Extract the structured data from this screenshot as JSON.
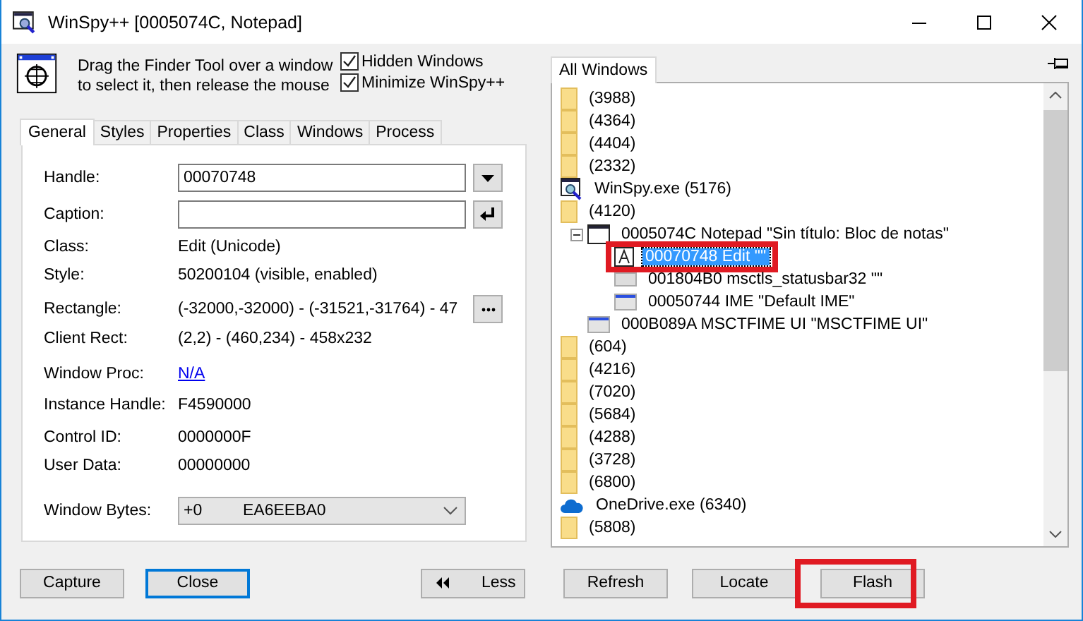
{
  "window": {
    "title": "WinSpy++ [0005074C, Notepad]"
  },
  "finder": {
    "hint": "Drag the Finder Tool over a window to select it, then release the mouse"
  },
  "options": [
    {
      "label": "Hidden Windows",
      "checked": true
    },
    {
      "label": "Minimize WinSpy++",
      "checked": true
    }
  ],
  "tabs": [
    {
      "label": "General",
      "selected": true
    },
    {
      "label": "Styles",
      "selected": false
    },
    {
      "label": "Properties",
      "selected": false
    },
    {
      "label": "Class",
      "selected": false
    },
    {
      "label": "Windows",
      "selected": false
    },
    {
      "label": "Process",
      "selected": false
    }
  ],
  "fields": [
    {
      "kind": "input",
      "label": "Handle:",
      "value": "00070748"
    },
    {
      "kind": "input_enter",
      "label": "Caption:"
    },
    {
      "kind": "text",
      "label": "Class:",
      "value": "Edit  (Unicode)"
    },
    {
      "kind": "text",
      "label": "Style:",
      "value": "50200104  (visible, enabled)"
    },
    {
      "kind": "text_more",
      "label": "Rectangle:",
      "value": "(-32000,-32000) - (-31521,-31764)  -  47"
    },
    {
      "kind": "text",
      "label": "Client Rect:",
      "value": "(2,2) - (460,234)  -  458x232"
    },
    {
      "kind": "link",
      "label": "Window Proc:",
      "value": "N/A"
    },
    {
      "kind": "text",
      "label": "Instance Handle:",
      "value": "F4590000"
    },
    {
      "kind": "text",
      "label": "Control ID:",
      "value": "0000000F"
    },
    {
      "kind": "text",
      "label": "User Data:",
      "value": "00000000"
    },
    {
      "kind": "combo",
      "label": "Window Bytes:",
      "value": "+0",
      "value_2": "EA6EEBA0"
    }
  ],
  "tree": {
    "tab": "All Windows",
    "nodes": [
      {
        "kind": "folder",
        "label": "(3988)",
        "selected": false,
        "highlighted": false
      },
      {
        "kind": "folder",
        "label": "(4364)",
        "selected": false,
        "highlighted": false
      },
      {
        "kind": "folder",
        "label": "(4404)",
        "selected": false,
        "highlighted": false
      },
      {
        "kind": "folder",
        "label": "(2332)",
        "selected": false,
        "highlighted": false
      },
      {
        "kind": "app",
        "label": "WinSpy.exe  (5176)",
        "selected": false,
        "highlighted": false
      },
      {
        "kind": "folder",
        "label": "(4120)",
        "selected": false,
        "highlighted": false,
        "children": [
          {
            "kind": "window",
            "label": "0005074C  Notepad  \"Sin título: Bloc de notas\"",
            "selected": false,
            "highlighted": false,
            "expanded": true,
            "children": [
              {
                "kind": "edit",
                "label": "00070748  Edit  \"\"",
                "selected": true,
                "highlighted": true
              },
              {
                "kind": "statusbar",
                "label": "001804B0  msctls_statusbar32  \"\"",
                "selected": false,
                "highlighted": false
              },
              {
                "kind": "ime",
                "label": "00050744  IME  \"Default IME\"",
                "selected": false,
                "highlighted": false
              }
            ]
          },
          {
            "kind": "ime",
            "label": "000B089A  MSCTFIME UI  \"MSCTFIME UI\"",
            "selected": false,
            "highlighted": false
          }
        ]
      },
      {
        "kind": "folder",
        "label": "(604)",
        "selected": false,
        "highlighted": false
      },
      {
        "kind": "folder",
        "label": "(4216)",
        "selected": false,
        "highlighted": false
      },
      {
        "kind": "folder",
        "label": "(7020)",
        "selected": false,
        "highlighted": false
      },
      {
        "kind": "folder",
        "label": "(5684)",
        "selected": false,
        "highlighted": false
      },
      {
        "kind": "folder",
        "label": "(4288)",
        "selected": false,
        "highlighted": false
      },
      {
        "kind": "folder",
        "label": "(3728)",
        "selected": false,
        "highlighted": false
      },
      {
        "kind": "folder",
        "label": "(6800)",
        "selected": false,
        "highlighted": false
      },
      {
        "kind": "cloud",
        "label": "OneDrive.exe  (6340)",
        "selected": false,
        "highlighted": false
      },
      {
        "kind": "folder",
        "label": "(5808)",
        "selected": false,
        "highlighted": false
      }
    ]
  },
  "buttons": [
    {
      "kind": "plain",
      "label": "Capture",
      "focused": false,
      "highlighted": false
    },
    {
      "kind": "plain",
      "label": "Close",
      "focused": true,
      "highlighted": false
    },
    {
      "kind": "less",
      "label": "Less",
      "focused": false,
      "highlighted": false
    },
    {
      "kind": "plain",
      "label": "Refresh",
      "focused": false,
      "highlighted": false
    },
    {
      "kind": "plain",
      "label": "Locate",
      "focused": false,
      "highlighted": false
    },
    {
      "kind": "plain",
      "label": "Flash",
      "focused": false,
      "highlighted": true
    }
  ]
}
